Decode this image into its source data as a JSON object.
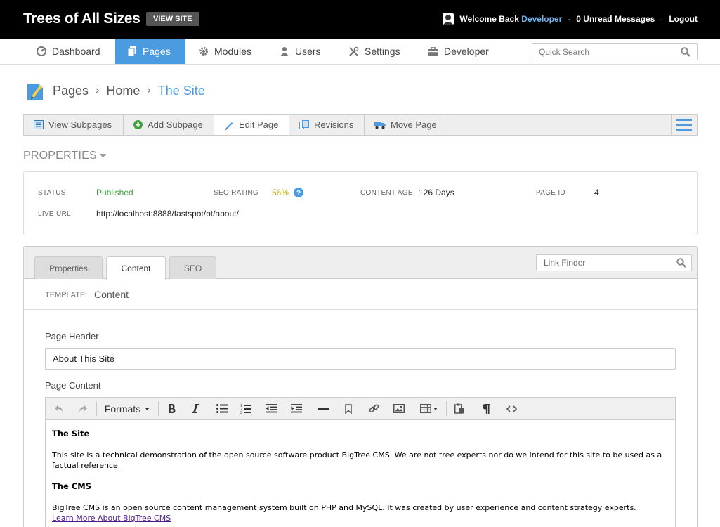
{
  "header": {
    "site_title": "Trees of All Sizes",
    "view_site_label": "VIEW SITE",
    "welcome_text": "Welcome Back",
    "user_name": "Developer",
    "separator": "·",
    "messages": "0 Unread Messages",
    "logout": "Logout"
  },
  "nav": {
    "items": [
      {
        "label": "Dashboard",
        "icon": "dashboard-icon"
      },
      {
        "label": "Pages",
        "icon": "pages-icon",
        "active": true
      },
      {
        "label": "Modules",
        "icon": "gear-icon"
      },
      {
        "label": "Users",
        "icon": "user-icon"
      },
      {
        "label": "Settings",
        "icon": "tools-icon"
      },
      {
        "label": "Developer",
        "icon": "briefcase-icon"
      }
    ],
    "search_placeholder": "Quick Search"
  },
  "breadcrumb": {
    "items": [
      "Pages",
      "Home",
      "The Site"
    ],
    "separator": "›"
  },
  "subnav": {
    "items": [
      {
        "label": "View Subpages",
        "icon": "list-icon"
      },
      {
        "label": "Add Subpage",
        "icon": "plus-circle-icon"
      },
      {
        "label": "Edit Page",
        "icon": "pencil-icon",
        "active": true
      },
      {
        "label": "Revisions",
        "icon": "revisions-icon"
      },
      {
        "label": "Move Page",
        "icon": "truck-icon"
      }
    ]
  },
  "properties": {
    "heading": "PROPERTIES",
    "status_label": "STATUS",
    "status_value": "Published",
    "seo_label": "SEO RATING",
    "seo_value": "56%",
    "age_label": "CONTENT AGE",
    "age_value": "126 Days",
    "id_label": "PAGE ID",
    "id_value": "4",
    "url_label": "LIVE URL",
    "url_value": "http://localhost:8888/fastspot/bt/about/"
  },
  "editor": {
    "tabs": [
      {
        "label": "Properties"
      },
      {
        "label": "Content",
        "active": true
      },
      {
        "label": "SEO"
      }
    ],
    "link_finder_placeholder": "Link Finder",
    "template_label": "TEMPLATE:",
    "template_value": "Content",
    "page_header_label": "Page Header",
    "page_header_value": "About This Site",
    "page_content_label": "Page Content",
    "toolbar": {
      "formats_label": "Formats"
    },
    "content": {
      "h1": "The Site",
      "p1": "This site is a technical demonstration of the open source software product BigTree CMS. We are not tree experts nor do we intend for this site to be used as a factual reference.",
      "h2": "The CMS",
      "p2": "BigTree CMS is an open source content management system built on PHP and MySQL. It was created by user experience and content strategy experts.",
      "link": "Learn More About BigTree CMS"
    }
  },
  "colors": {
    "accent": "#4a9be0",
    "published": "#3aa63a",
    "seo": "#c7a818",
    "link_visited": "#4b1c8a"
  }
}
